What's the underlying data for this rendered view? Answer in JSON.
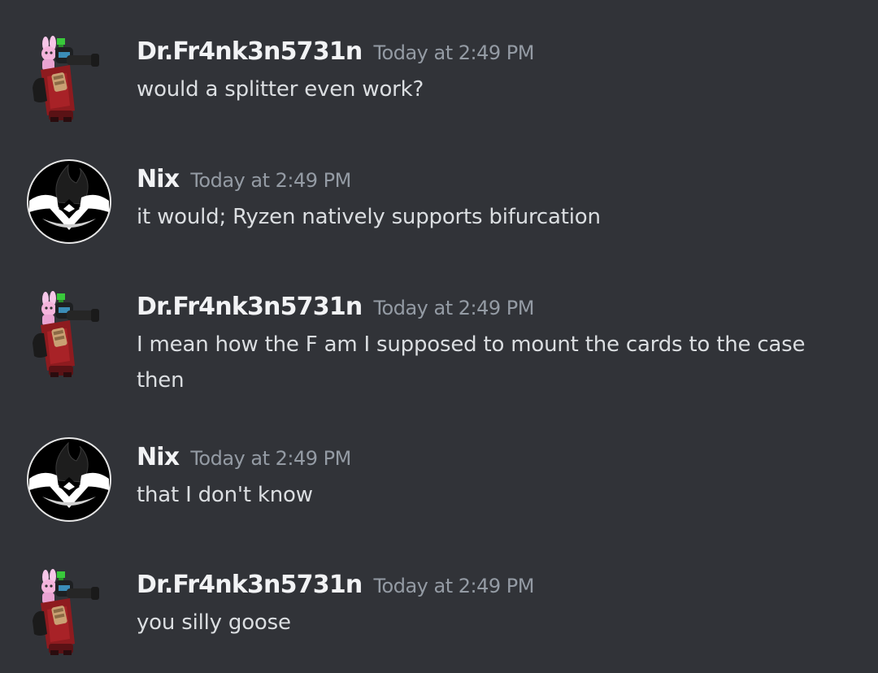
{
  "messages": [
    {
      "author": "Dr.Fr4nk3n5731n",
      "timestamp": "Today at 2:49 PM",
      "text": "would a splitter even work?",
      "avatar": "robot-avatar"
    },
    {
      "author": "Nix",
      "timestamp": "Today at 2:49 PM",
      "text": "it would; Ryzen natively supports bifurcation",
      "avatar": "logo-avatar"
    },
    {
      "author": "Dr.Fr4nk3n5731n",
      "timestamp": "Today at 2:49 PM",
      "text": "I mean how the F am I supposed to mount the cards to the case then",
      "avatar": "robot-avatar"
    },
    {
      "author": "Nix",
      "timestamp": "Today at 2:49 PM",
      "text": "that I don't know",
      "avatar": "logo-avatar"
    },
    {
      "author": "Dr.Fr4nk3n5731n",
      "timestamp": "Today at 2:49 PM",
      "text": "you silly goose",
      "avatar": "robot-avatar"
    }
  ],
  "colors": {
    "background": "#313338",
    "username": "#f2f3f5",
    "timestamp": "#949ba4",
    "text": "#dbdee1"
  }
}
